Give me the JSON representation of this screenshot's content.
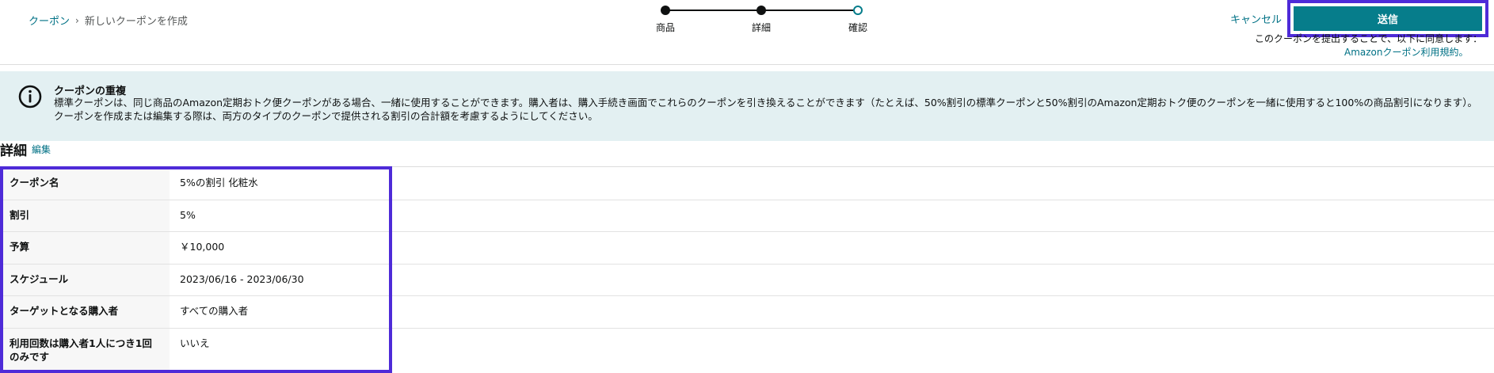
{
  "breadcrumb": {
    "parent": "クーポン",
    "separator": "›",
    "current": "新しいクーポンを作成"
  },
  "stepper": {
    "steps": [
      {
        "label": "商品",
        "state": "complete"
      },
      {
        "label": "詳細",
        "state": "complete"
      },
      {
        "label": "確認",
        "state": "current"
      }
    ]
  },
  "actions": {
    "cancel_label": "キャンセル",
    "submit_label": "送信",
    "consent_text": "このクーポンを提出することで、以下に同意します：",
    "consent_link": "Amazonクーポン利用規約。"
  },
  "alert": {
    "icon": "info-icon",
    "title": "クーポンの重複",
    "body": "標準クーポンは、同じ商品のAmazon定期おトク便クーポンがある場合、一緒に使用することができます。購入者は、購入手続き画面でこれらのクーポンを引き換えることができます（たとえば、50%割引の標準クーポンと50%割引のAmazon定期おトク便のクーポンを一緒に使用すると100%の商品割引になります）。クーポンを作成または編集する際は、両方のタイプのクーポンで提供される割引の合計額を考慮するようにしてください。"
  },
  "details": {
    "title": "詳細",
    "edit_label": "編集",
    "rows": [
      {
        "label": "クーポン名",
        "value": "5%の割引 化粧水"
      },
      {
        "label": "割引",
        "value": "5%"
      },
      {
        "label": "予算",
        "value": "￥10,000"
      },
      {
        "label": "スケジュール",
        "value": "2023/06/16 - 2023/06/30"
      },
      {
        "label": "ターゲットとなる購入者",
        "value": "すべての購入者"
      },
      {
        "label": "利用回数は購入者1人につき1回のみです",
        "value": "いいえ"
      }
    ]
  },
  "colors": {
    "accent": "#067d8b",
    "link": "#007185",
    "highlight": "#4e2bd8",
    "alert_bg": "#e3f0f2"
  }
}
